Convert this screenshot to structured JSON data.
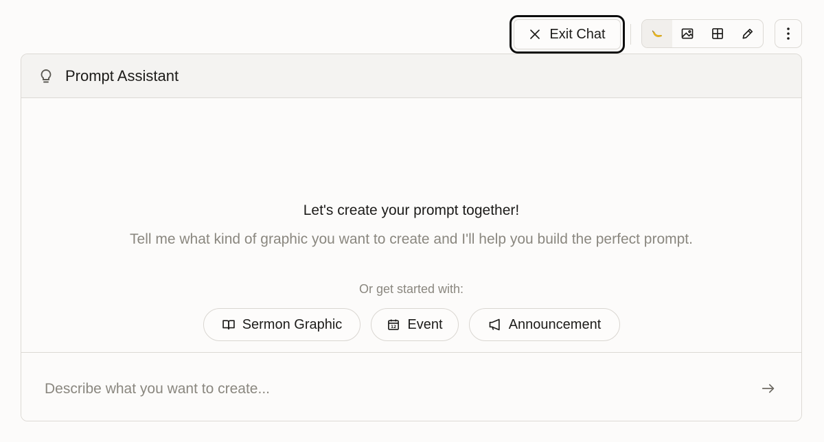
{
  "toolbar": {
    "exit_label": "Exit Chat",
    "tools": [
      {
        "icon": "banana-icon",
        "active": true
      },
      {
        "icon": "image-icon",
        "active": false
      },
      {
        "icon": "grid-icon",
        "active": false
      },
      {
        "icon": "pencil-icon",
        "active": false
      }
    ],
    "more_icon": "more-vertical-icon"
  },
  "assistant": {
    "title": "Prompt Assistant",
    "title_icon": "lightbulb-icon",
    "headline": "Let's create your prompt together!",
    "subline": "Tell me what kind of graphic you want to create and I'll help you build the perfect prompt.",
    "starter_label": "Or get started with:",
    "starters": [
      {
        "label": "Sermon Graphic",
        "icon": "book-open-icon"
      },
      {
        "label": "Event",
        "icon": "calendar-icon"
      },
      {
        "label": "Announcement",
        "icon": "megaphone-icon"
      }
    ]
  },
  "composer": {
    "placeholder": "Describe what you want to create...",
    "value": "",
    "send_icon": "arrow-right-icon"
  },
  "colors": {
    "background": "#fcfbfa",
    "header_bg": "#f4f3f1",
    "border": "#dcd9d4",
    "text": "#1c1b19",
    "muted_text": "#8a877f",
    "focus_ring": "#0d0d0d",
    "banana": "#f2c01f"
  }
}
